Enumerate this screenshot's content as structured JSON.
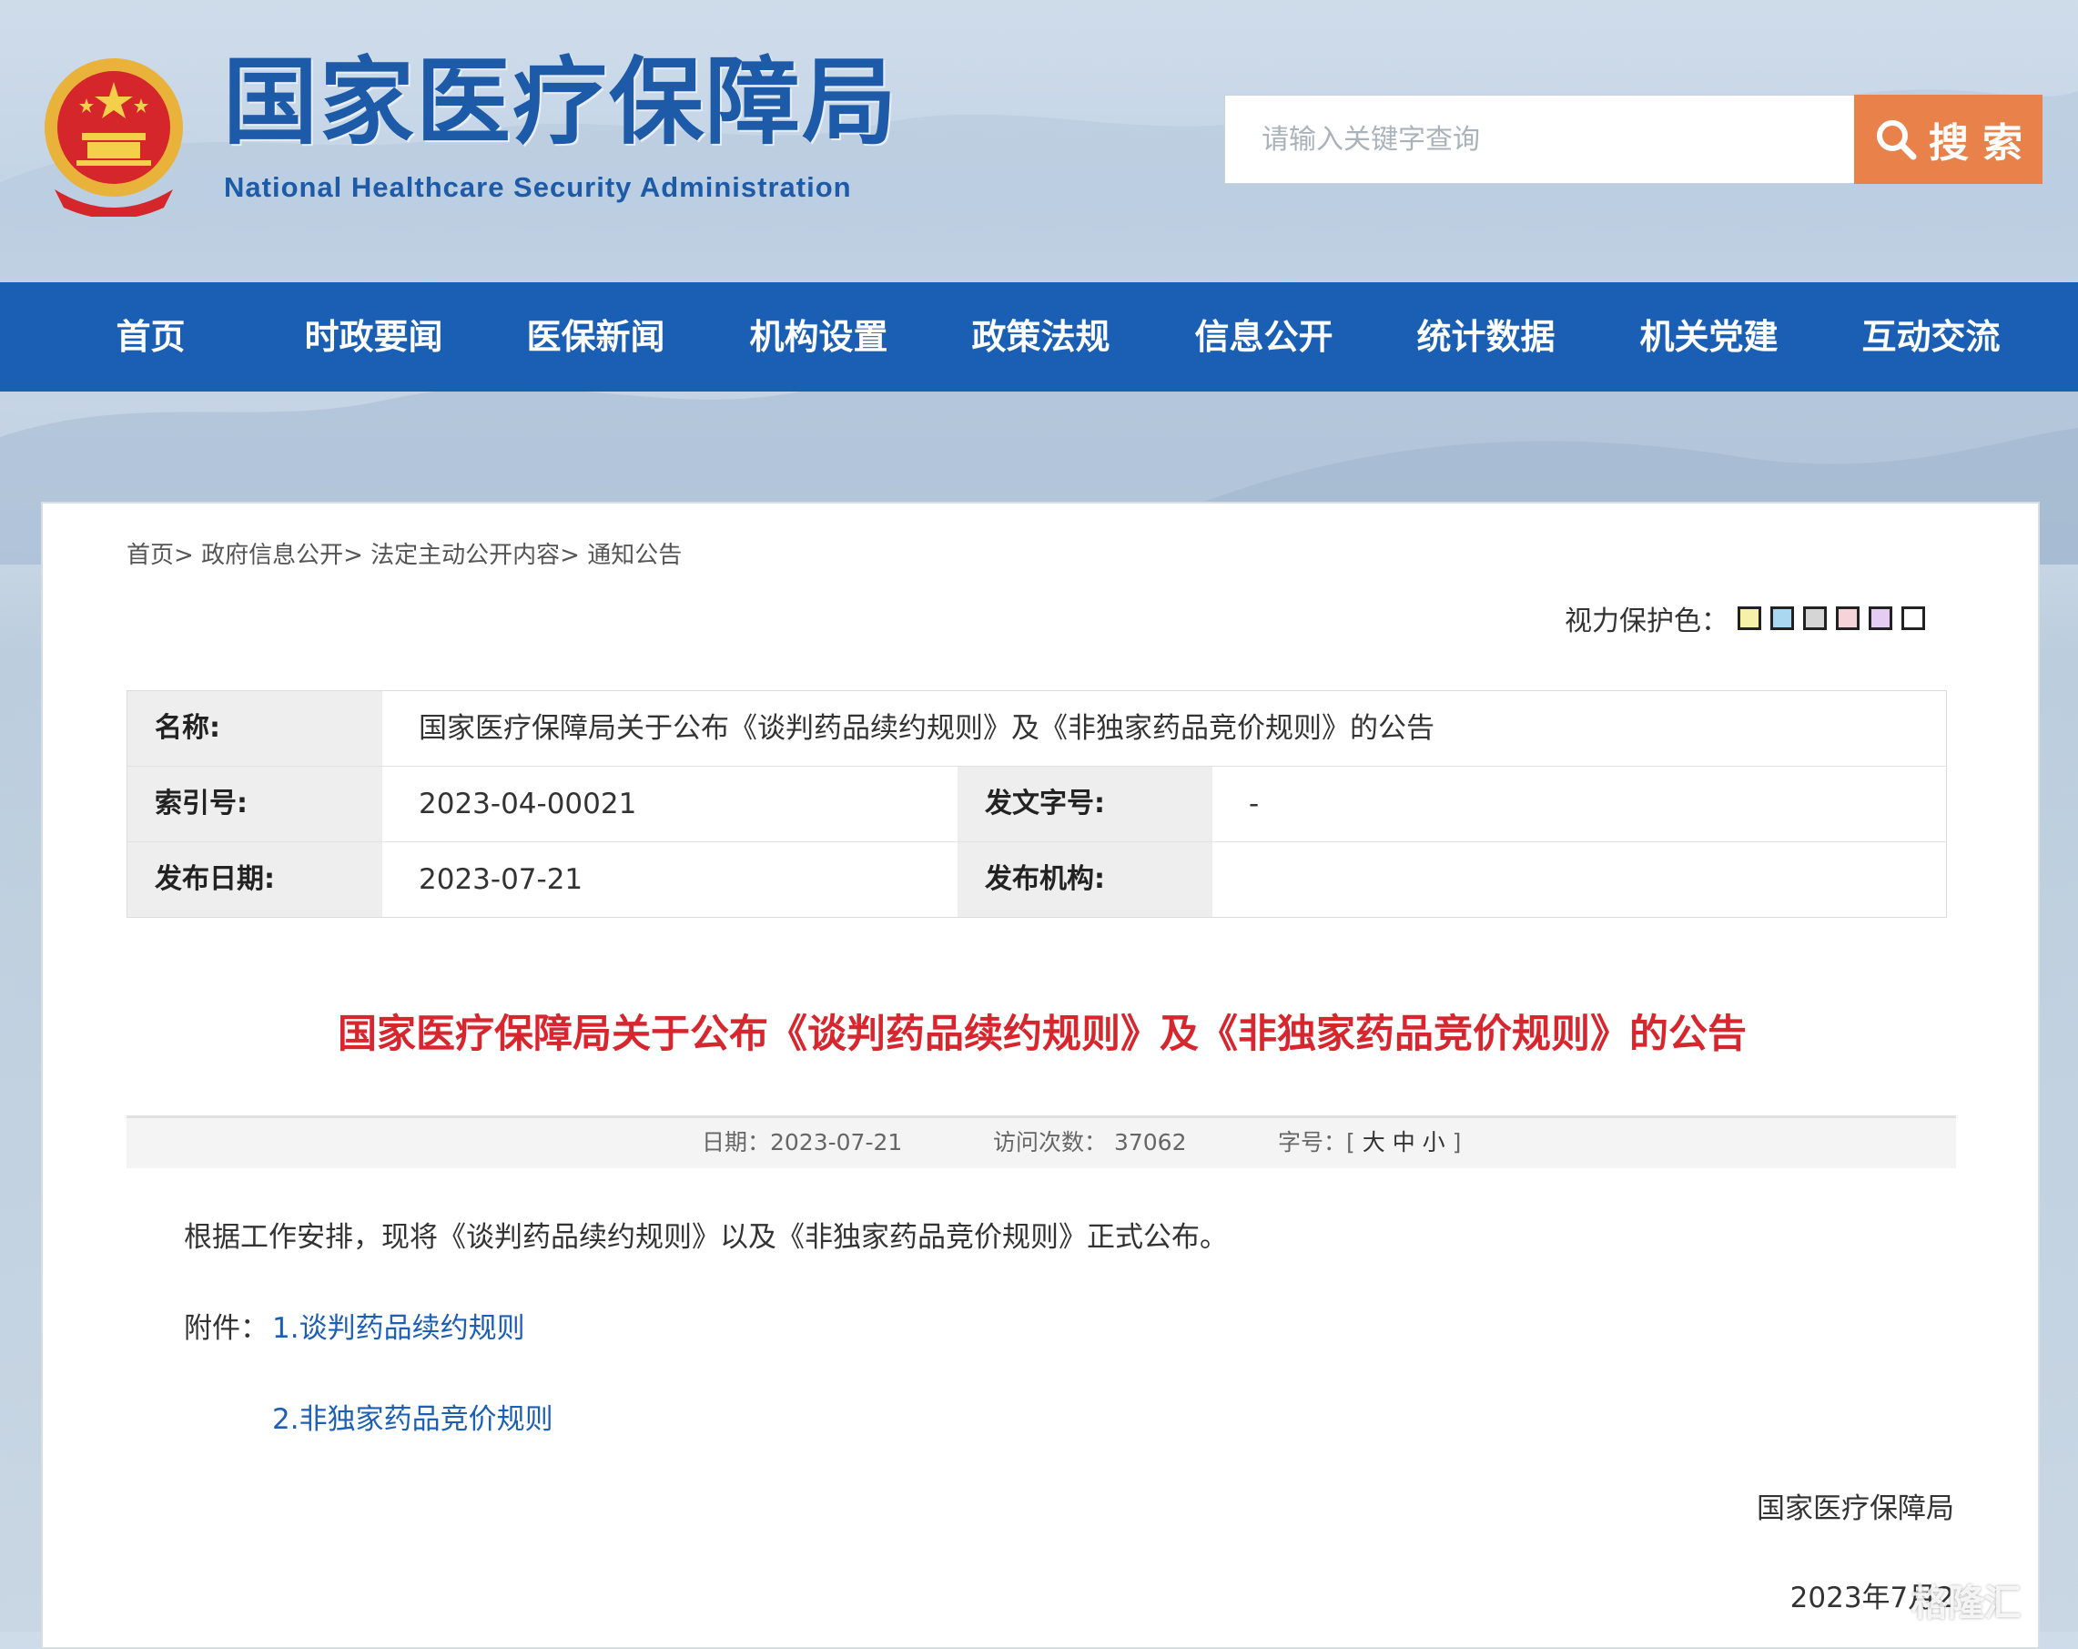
{
  "header": {
    "title": "国家医疗保障局",
    "subtitle": "National Healthcare Security Administration",
    "search": {
      "placeholder": "请输入关键字查询",
      "button_label": "搜 索"
    }
  },
  "nav": {
    "items": [
      "首页",
      "时政要闻",
      "医保新闻",
      "机构设置",
      "政策法规",
      "信息公开",
      "统计数据",
      "机关党建",
      "互动交流"
    ]
  },
  "breadcrumb": [
    "首页>",
    "政府信息公开>",
    "法定主动公开内容>",
    "通知公告"
  ],
  "vision_protect": {
    "label": "视力保护色：",
    "colors": [
      "#f7f0a8",
      "#a9d8f0",
      "#d5d5d5",
      "#f6d3d9",
      "#e5ccf2",
      "#ffffff"
    ]
  },
  "meta": {
    "name_label": "名称:",
    "name_value": "国家医疗保障局关于公布《谈判药品续约规则》及《非独家药品竞价规则》的公告",
    "index_label": "索引号:",
    "index_value": "2023-04-00021",
    "doc_no_label": "发文字号:",
    "doc_no_value": "-",
    "date_label": "发布日期:",
    "date_value": "2023-07-21",
    "org_label": "发布机构:",
    "org_value": ""
  },
  "article": {
    "title": "国家医疗保障局关于公布《谈判药品续约规则》及《非独家药品竞价规则》的公告",
    "date_text": "日期：2023-07-21",
    "visits_text": "访问次数：  37062",
    "font_label": "字号：[",
    "font_large": "大",
    "font_medium": "中",
    "font_small": "小",
    "font_end": "]",
    "body": "根据工作安排，现将《谈判药品续约规则》以及《非独家药品竞价规则》正式公布。",
    "attachments_label": "附件：",
    "attachments": [
      "1.谈判药品续约规则",
      "2.非独家药品竞价规则"
    ],
    "signer": "国家医疗保障局",
    "sign_date": "2023年7月2"
  },
  "watermark": "格隆汇"
}
